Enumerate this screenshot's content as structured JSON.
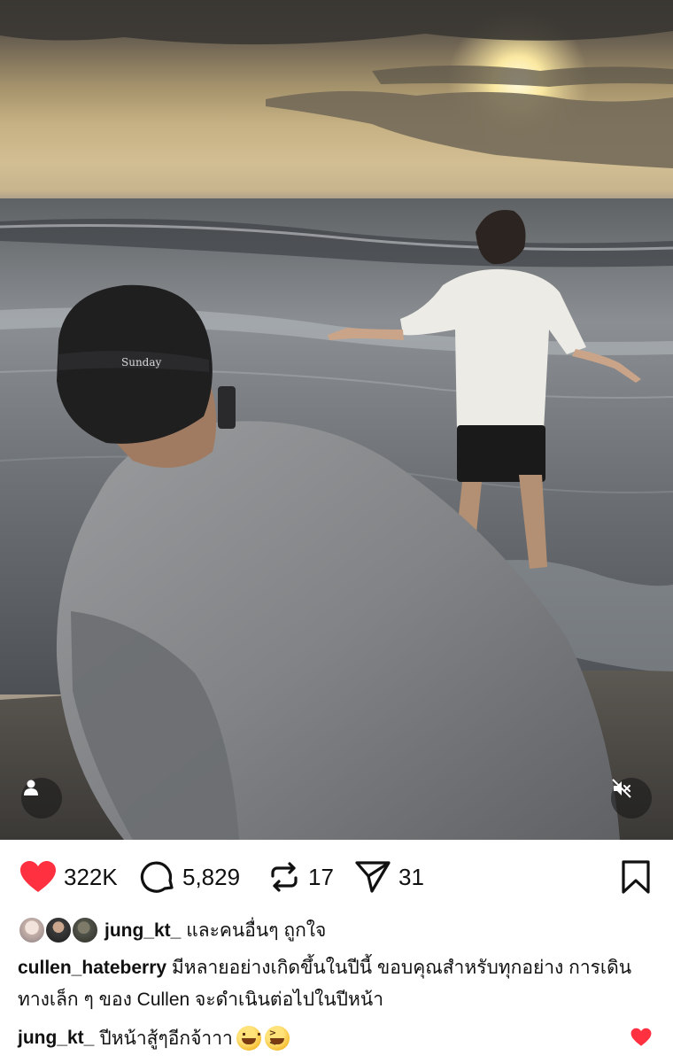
{
  "post": {
    "photo_alt": "",
    "cap_brand": "Sunday"
  },
  "actions": {
    "likes": "322K",
    "comments": "5,829",
    "reposts": "17",
    "shares": "31"
  },
  "liked_by": {
    "username": "jung_kt_",
    "suffix": " และคนอื่นๆ ถูกใจ"
  },
  "caption": {
    "username": "cullen_hateberry",
    "text": " มีหลายอย่างเกิดขึ้นในปีนี้ ขอบคุณสำหรับทุกอย่าง การเดินทางเล็ก ๆ ของ Cullen จะดำเนินต่อไปในปีหน้า"
  },
  "comment": {
    "username": "jung_kt_",
    "text": "ปีหน้าสู้ๆอีกจ้าาา"
  },
  "icons": {
    "like": "heart-filled-icon",
    "comment": "comment-bubble-icon",
    "repost": "repost-icon",
    "share": "send-icon",
    "save": "bookmark-icon",
    "user_tag": "user-icon",
    "mute": "speaker-muted-icon",
    "comment_like": "heart-filled-icon"
  },
  "colors": {
    "like_red": "#ff3040",
    "text": "#111111"
  }
}
